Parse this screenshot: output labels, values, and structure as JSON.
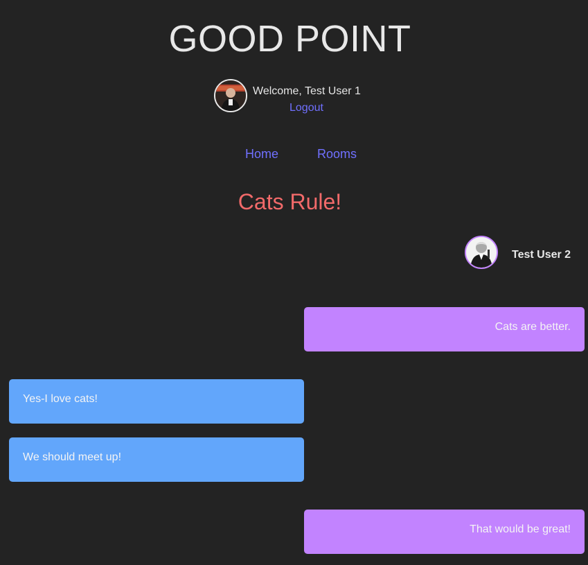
{
  "app": {
    "title": "GOOD POINT"
  },
  "user": {
    "welcome": "Welcome, Test User 1",
    "logout_label": "Logout",
    "avatar_icon": "user-avatar-photo"
  },
  "nav": {
    "items": [
      {
        "label": "Home"
      },
      {
        "label": "Rooms"
      }
    ]
  },
  "room": {
    "title": "Cats Rule!",
    "participant": {
      "name": "Test User 2",
      "avatar_icon": "participant-avatar-photo"
    }
  },
  "messages": [
    {
      "side": "right",
      "text": "Cats are better."
    },
    {
      "side": "left",
      "text": "Yes-I love cats!"
    },
    {
      "side": "left",
      "text": "We should meet up!"
    },
    {
      "side": "right",
      "text": "That would be great!"
    }
  ],
  "colors": {
    "background": "#232323",
    "link": "#7070ff",
    "room_title": "#f26a6a",
    "other_bubble": "#c283ff",
    "own_bubble": "#62a6fb"
  }
}
